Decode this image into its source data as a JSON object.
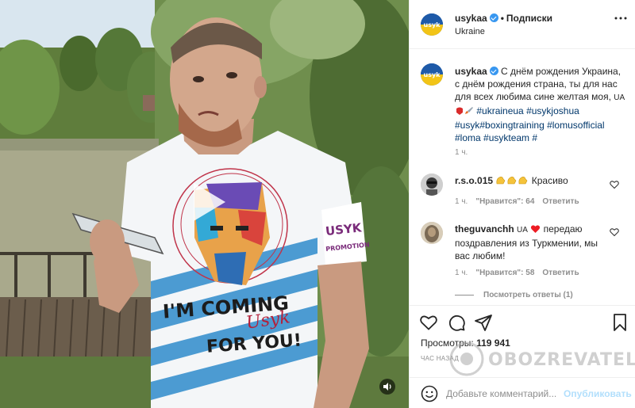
{
  "post": {
    "username": "usykaa",
    "follow_label": "Подписки",
    "location": "Ukraine",
    "caption": {
      "text": "С днём рождения Украина, с днём рождения страна, ты для нас для всех любима сине желтая моя,",
      "flag": "UA",
      "hashtags": [
        "#ukraineua",
        "#usykjoshua",
        "#usyk#boxingtraining",
        "#lomusofficial",
        "#loma",
        "#usykteam",
        "#"
      ],
      "time": "1 ч."
    },
    "comments": [
      {
        "username": "r.s.o.015",
        "text": "Красиво",
        "time": "1 ч.",
        "likes_label": "\"Нравится\": 64",
        "reply_label": "Ответить"
      },
      {
        "username": "theguvanchh",
        "flag": "UA",
        "text": "передаю поздравления из Туркмении, мы вас любим!",
        "time": "1 ч.",
        "likes_label": "\"Нравится\": 58",
        "reply_label": "Ответить",
        "view_replies": "Посмотреть ответы (1)"
      }
    ],
    "views_label": "Просмотры:",
    "views_count": "119 941",
    "post_time": "ЧАС НАЗАД",
    "add_comment_placeholder": "Добавьте комментарий...",
    "publish_label": "Опубликовать"
  },
  "video": {
    "shirt_text_line1": "I'M COMING",
    "shirt_text_signature": "Usyk",
    "shirt_text_line2": "FOR YOU!",
    "sleeve_logo": "USYK",
    "sleeve_sub": "PROMOTION",
    "avatar_logo": "usyk"
  },
  "watermark": "OBOZREVATEL",
  "colors": {
    "link": "#00376b",
    "verified": "#3897f0",
    "publish_disabled": "#b2dffc",
    "muted": "#8e8e8e",
    "heart_red": "#ed4956"
  },
  "icons": [
    "play-icon",
    "mute-icon",
    "more-icon",
    "heart-icon",
    "comment-icon",
    "share-icon",
    "bookmark-icon",
    "emoji-icon",
    "verified-icon"
  ]
}
